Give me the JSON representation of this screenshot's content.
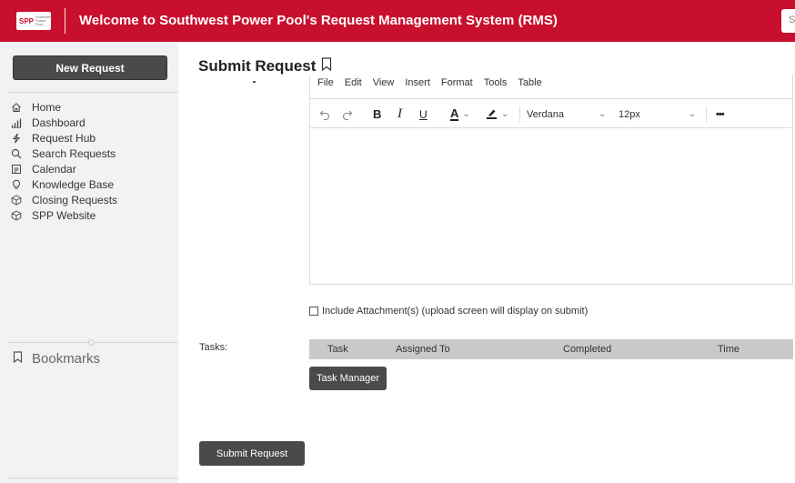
{
  "header": {
    "logo_text": "SPP",
    "logo_sub": "Southwest Power Pool",
    "title": "Welcome to Southwest Power Pool's Request Management System (RMS)",
    "search_hint": "S"
  },
  "sidebar": {
    "new_request_label": "New Request",
    "nav_items": [
      {
        "label": "Home",
        "icon": "home-icon"
      },
      {
        "label": "Dashboard",
        "icon": "bar-chart-icon"
      },
      {
        "label": "Request Hub",
        "icon": "lightning-icon"
      },
      {
        "label": "Search Requests",
        "icon": "search-icon"
      },
      {
        "label": "Calendar",
        "icon": "calendar-icon"
      },
      {
        "label": "Knowledge Base",
        "icon": "lightbulb-icon"
      },
      {
        "label": "Closing Requests",
        "icon": "cube-icon"
      },
      {
        "label": "SPP Website",
        "icon": "cube-icon"
      }
    ],
    "bookmarks_label": "Bookmarks"
  },
  "main": {
    "page_title": "Submit Request",
    "editor": {
      "menu": [
        "File",
        "Edit",
        "View",
        "Insert",
        "Format",
        "Tools",
        "Table"
      ],
      "font": "Verdana",
      "font_size": "12px",
      "more": "•••",
      "bold": "B",
      "italic": "I",
      "underline": "U",
      "text_color": "A"
    },
    "attachment_label": "Include Attachment(s) (upload screen will display on submit)",
    "tasks_label": "Tasks:",
    "task_columns": [
      "Task",
      "Assigned To",
      "Completed",
      "Time"
    ],
    "task_manager_label": "Task Manager",
    "submit_label": "Submit Request"
  }
}
